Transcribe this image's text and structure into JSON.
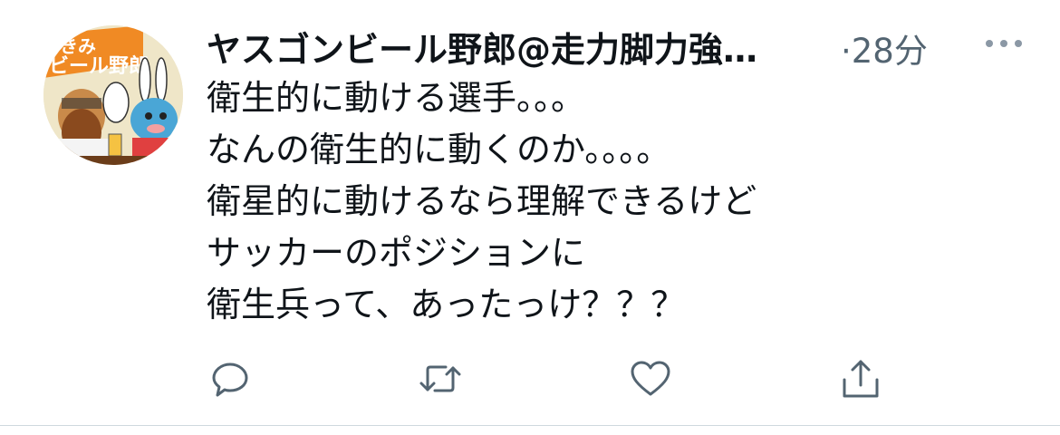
{
  "tweet": {
    "display_name": "ヤスゴンビール野郎@走力脚力強…",
    "timestamp": "·28分",
    "body_lines": [
      "衛生的に動ける選手。。。",
      "なんの衛生的に動くのか。。。。",
      "衛星的に動けるなら理解できるけど",
      "サッカーのポジションに",
      "衛生兵って、あったっけ？？？"
    ],
    "avatar_text": {
      "top_left": "きみ",
      "banner": "ビール野郎"
    }
  },
  "icons": {
    "more": "more-horizontal-icon",
    "reply": "reply-icon",
    "retweet": "retweet-icon",
    "like": "heart-icon",
    "share": "share-icon"
  },
  "colors": {
    "text": "#0f1419",
    "secondary": "#536471",
    "divider": "#cfd9de",
    "icon": "#536471"
  }
}
